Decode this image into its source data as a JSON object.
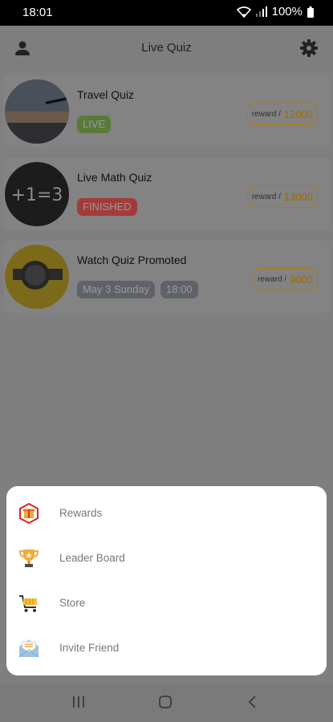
{
  "status_bar": {
    "time": "18:01",
    "battery": "100%"
  },
  "app_bar": {
    "title": "Live Quiz"
  },
  "quizzes": [
    {
      "name": "Travel Quiz",
      "badge": "LIVE",
      "badge_color": "#5a7a3a",
      "reward_label": "reward /",
      "reward_value": "12000"
    },
    {
      "name": "Live Math Quiz",
      "badge": "FINISHED",
      "badge_color": "#a53a3a",
      "reward_label": "reward /",
      "reward_value": "13000"
    },
    {
      "name": "Watch Quiz Promoted",
      "badge": "May 3 Sunday",
      "badge2": "18:00",
      "badge_color": "#5f6369",
      "reward_label": "reward /",
      "reward_value": "9000"
    }
  ],
  "menu": {
    "items": [
      {
        "label": "Rewards",
        "icon": "gift-icon"
      },
      {
        "label": "Leader Board",
        "icon": "trophy-icon"
      },
      {
        "label": "Store",
        "icon": "cart-icon"
      },
      {
        "label": "Invite Friend",
        "icon": "envelope-icon"
      }
    ]
  },
  "colors": {
    "accent": "#e8a23a",
    "scrim": "#7f7f7f"
  }
}
